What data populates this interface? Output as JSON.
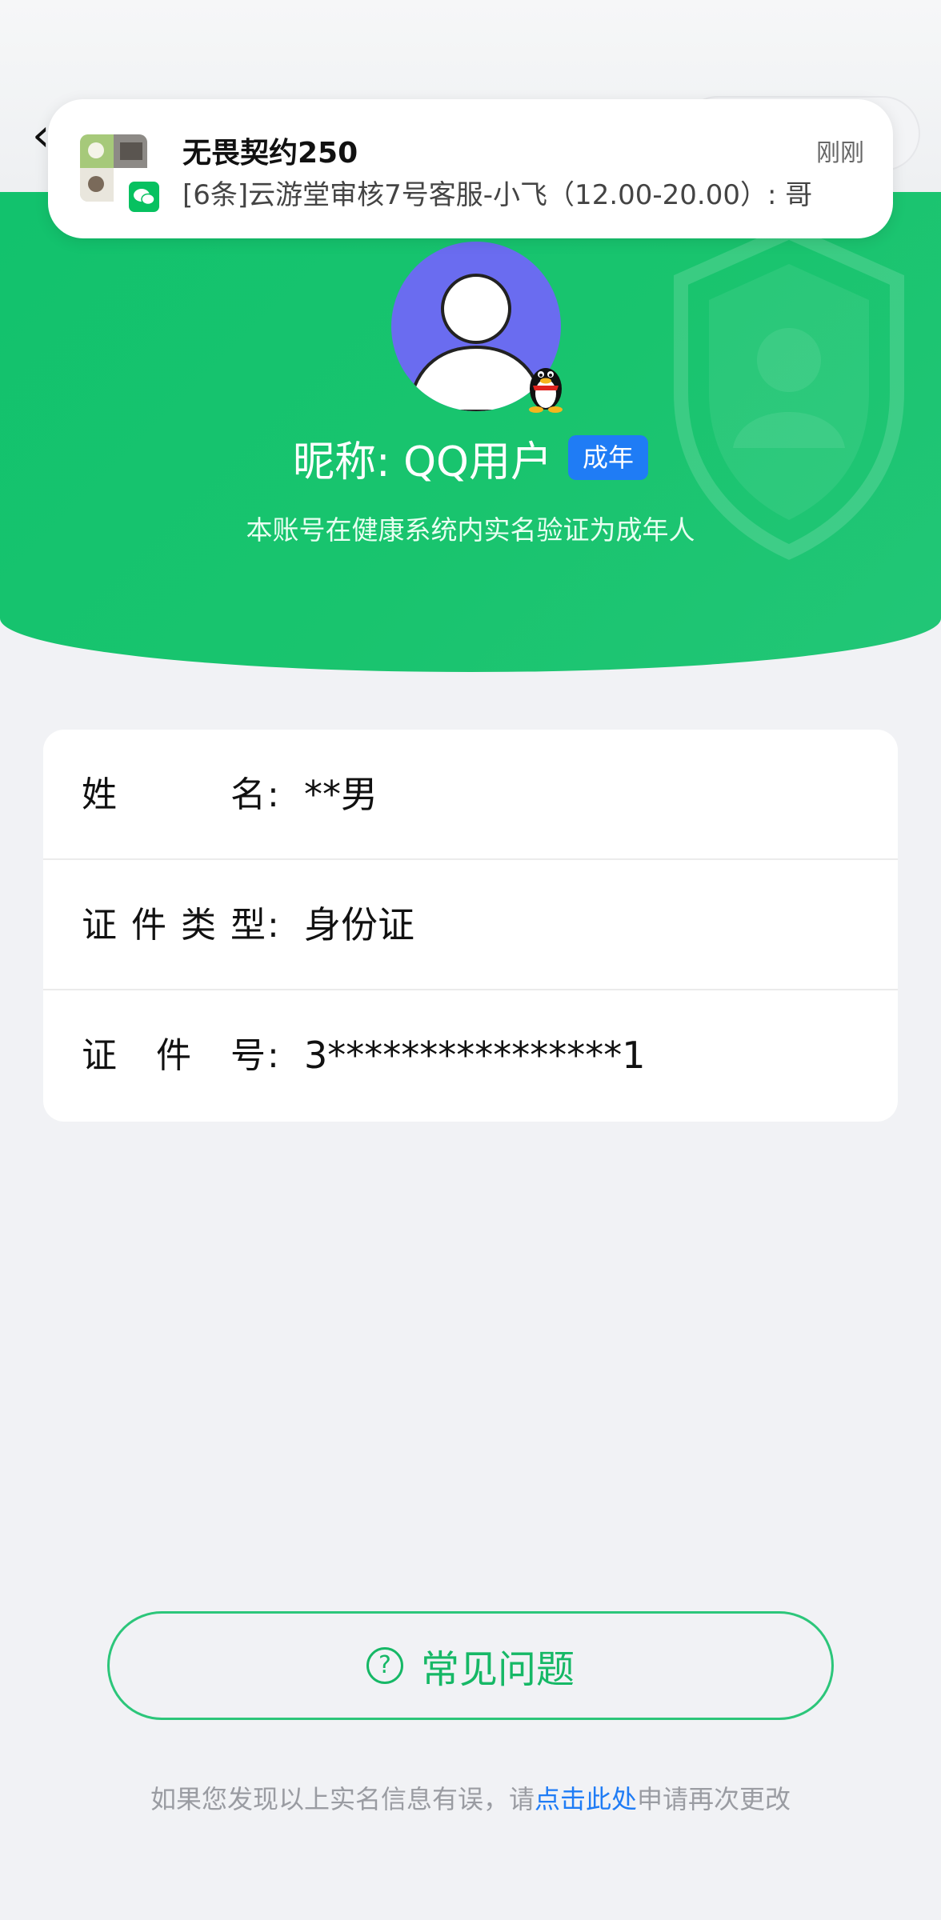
{
  "colors": {
    "brand_green": "#12c26d",
    "badge_blue": "#1f7cf5",
    "link_blue": "#1f7cf5",
    "avatar_bg": "#6a6cf0"
  },
  "notification": {
    "title": "无畏契约250",
    "time": "刚刚",
    "body": "[6条]云游堂审核7号客服-小飞（12.00-20.00）: 哥",
    "app_icon": "wechat-icon"
  },
  "profile": {
    "nickname": "昵称: QQ用户",
    "badge": "成年",
    "subtitle": "本账号在健康系统内实名验证为成年人"
  },
  "info": [
    {
      "label": "姓名",
      "value": "**男"
    },
    {
      "label": "证件类型",
      "value": "身份证"
    },
    {
      "label": "证件号",
      "value": "3****************1"
    }
  ],
  "faq": {
    "label": "常见问题",
    "icon": "question-circle-icon"
  },
  "footer": {
    "prefix": "如果您发现以上实名信息有误，请",
    "link": "点击此处",
    "suffix": "申请再次更改"
  }
}
